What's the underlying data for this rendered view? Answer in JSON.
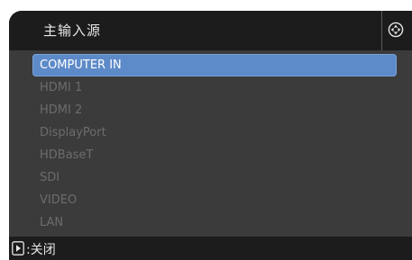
{
  "window": {
    "title": "主输入源"
  },
  "input_list": {
    "items": [
      {
        "label": "COMPUTER IN",
        "selected": true
      },
      {
        "label": "HDMI 1",
        "selected": false
      },
      {
        "label": "HDMI 2",
        "selected": false
      },
      {
        "label": "DisplayPort",
        "selected": false
      },
      {
        "label": "HDBaseT",
        "selected": false
      },
      {
        "label": "SDI",
        "selected": false
      },
      {
        "label": "VIDEO",
        "selected": false
      },
      {
        "label": "LAN",
        "selected": false
      }
    ]
  },
  "footer": {
    "close_label": ":关闭"
  },
  "icons": {
    "header": "navigation-dial-icon",
    "footer": "play-right-icon"
  },
  "colors": {
    "selection": "#5d8ac8",
    "panel": "#3b3b3b",
    "bar": "#1c1c1c"
  }
}
